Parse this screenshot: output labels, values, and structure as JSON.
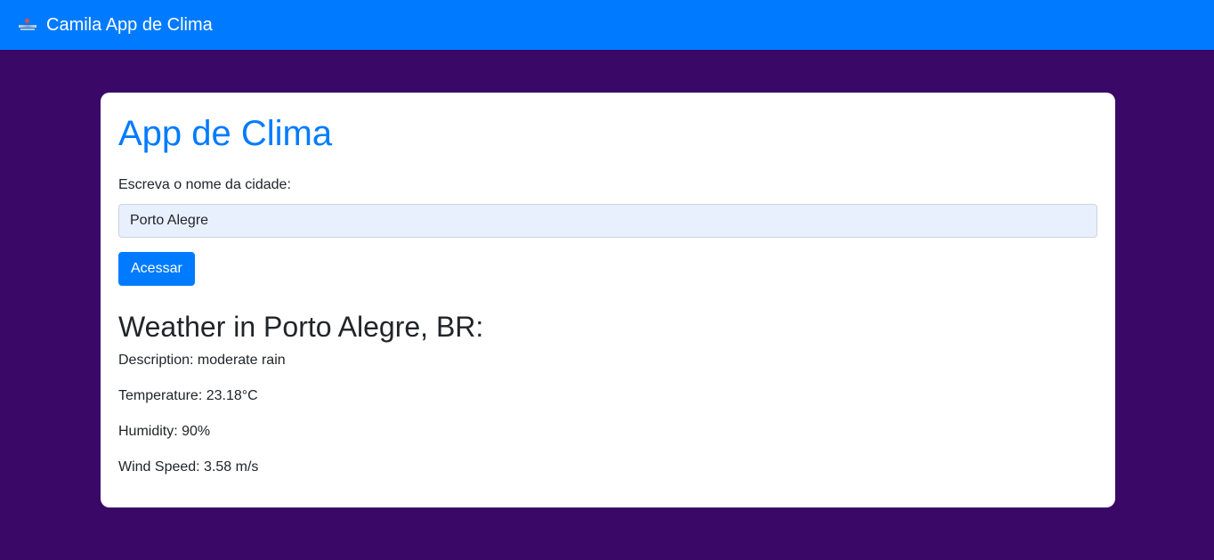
{
  "navbar": {
    "brand_title": "Camila App de Clima",
    "logo_icon": "app-logo-icon",
    "background_color": "#007bff"
  },
  "page": {
    "background_color": "#3a0866"
  },
  "card": {
    "title": "App de Clima",
    "city_label": "Escreva o nome da cidade:",
    "city_input_value": "Porto Alegre",
    "submit_label": "Acessar",
    "title_color": "#007bff"
  },
  "weather": {
    "heading": "Weather in Porto Alegre, BR:",
    "description": "Description: moderate rain",
    "temperature": "Temperature: 23.18°C",
    "humidity": "Humidity: 90%",
    "wind_speed": "Wind Speed: 3.58 m/s"
  }
}
